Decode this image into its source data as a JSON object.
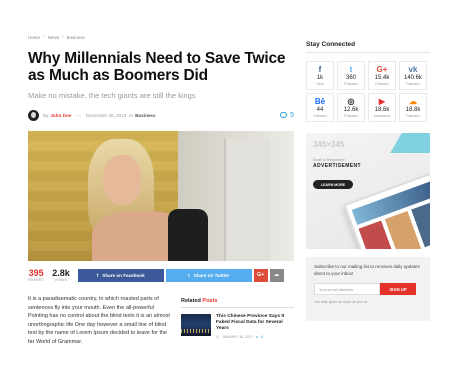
{
  "breadcrumb": [
    "Home",
    "News",
    "Business"
  ],
  "article": {
    "title": "Why Millennials Need to Save Twice as Much as Boomers Did",
    "subtitle": "Make no mistake, the tech giants are still the kings",
    "by_label": "By",
    "author": "John Doe",
    "dash": "—",
    "date": "December 30, 2016",
    "in_label": "In",
    "category": "Business",
    "comments": "5"
  },
  "share": {
    "shares_count": "395",
    "shares_label": "SHARES",
    "views_count": "2.8k",
    "views_label": "VIEWS",
    "facebook_label": "Share on Facebook",
    "twitter_label": "Share on Twitter",
    "gplus_label": "G+",
    "more_icon": "share-arrow-icon"
  },
  "body_text": "It is a paradisematic country, in which roasted parts of sentences fly into your mouth. Even the all-powerful Pointing has no control about the blind texts it is an almost unorthographic life One day however a small line of blind text by the name of Lorem Ipsum decided to leave for the far World of Grammar.",
  "related": {
    "head_prefix": "Related",
    "head_accent": "Posts",
    "items": [
      {
        "title": "This Chinese Province Says It Faked Fiscal Data for Several Years",
        "date": "JANUARY 18, 2017",
        "comments": "0"
      }
    ]
  },
  "sidebar": {
    "stay_connected": "Stay Connected",
    "social": [
      {
        "icon": "f",
        "name": "facebook-icon",
        "color": "#3b5998",
        "count": "1k",
        "label": "Fans"
      },
      {
        "icon": "t",
        "name": "twitter-icon",
        "color": "#55acee",
        "count": "360",
        "label": "Followers"
      },
      {
        "icon": "G+",
        "name": "gplus-icon",
        "color": "#dd4b39",
        "count": "15.4k",
        "label": "Followers"
      },
      {
        "icon": "vk",
        "name": "vk-icon",
        "color": "#4c75a3",
        "count": "140.6k",
        "label": "Followers"
      },
      {
        "icon": "Bē",
        "name": "behance-icon",
        "color": "#1769ff",
        "count": "44",
        "label": "Followers"
      },
      {
        "icon": "◎",
        "name": "instagram-icon",
        "color": "#222222",
        "count": "12.6k",
        "label": "Followers"
      },
      {
        "icon": "▶",
        "name": "youtube-icon",
        "color": "#e52d27",
        "count": "18.6k",
        "label": "Subscribers"
      },
      {
        "icon": "☁",
        "name": "soundcloud-icon",
        "color": "#ff8800",
        "count": "18.8k",
        "label": "Followers"
      }
    ],
    "ad": {
      "size": "345×345",
      "small": "Smart & Responsive",
      "big": "ADVERTISEMENT",
      "button": "LEARN MORE"
    },
    "newsletter": {
      "text": "Subscribe to our mailing list to receives daily updates direct to your inbox!",
      "placeholder": "Your email address",
      "button": "SIGN UP",
      "note": "*we hate spam as much as you do"
    }
  },
  "colors": {
    "accent": "#e4322b",
    "link": "#2ba1d8"
  }
}
